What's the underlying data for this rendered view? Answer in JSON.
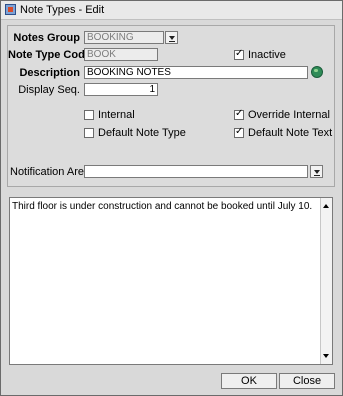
{
  "window": {
    "title": "Note Types - Edit"
  },
  "form": {
    "notes_group": {
      "label": "Notes Group",
      "value": "BOOKING"
    },
    "note_type_code": {
      "label": "Note Type Code",
      "value": "BOOK"
    },
    "inactive": {
      "label": "Inactive",
      "checked": true
    },
    "description": {
      "label": "Description",
      "value": "BOOKING NOTES"
    },
    "display_seq": {
      "label": "Display Seq.",
      "value": "1"
    },
    "internal": {
      "label": "Internal",
      "checked": false
    },
    "override_internal": {
      "label": "Override Internal",
      "checked": true
    },
    "default_note_type": {
      "label": "Default Note Type",
      "checked": false
    },
    "default_note_text": {
      "label": "Default Note Text",
      "checked": true
    },
    "notification_area": {
      "label": "Notification Area",
      "value": ""
    }
  },
  "note_text": "Third floor is under construction and cannot be booked until July 10.",
  "buttons": {
    "ok": "OK",
    "close": "Close"
  }
}
